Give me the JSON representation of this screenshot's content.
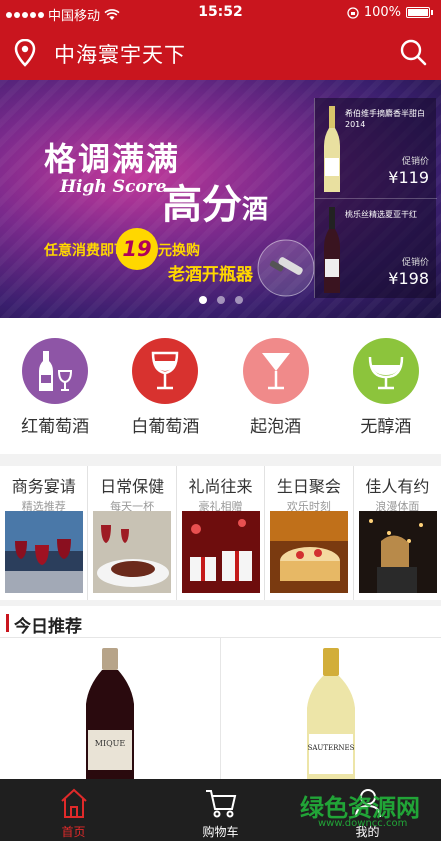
{
  "status_bar": {
    "carrier": "中国移动",
    "time": "15:52",
    "battery": "100%"
  },
  "header": {
    "title": "中海寰宇天下"
  },
  "banner": {
    "title_line1": "格调满满",
    "title_line2": "高分",
    "title_line2_suffix": "酒",
    "english": "High Score",
    "promo_prefix": "任意消费即可",
    "promo_number": "19",
    "promo_suffix": "元换购",
    "promo_item": "老酒开瓶器",
    "products": [
      {
        "name": "希伯维手摘麝香半甜白 2014",
        "price_label": "促销价",
        "price": "¥119"
      },
      {
        "name": "桃乐丝精选夏亚干红",
        "price_label": "促销价",
        "price": "¥198"
      }
    ],
    "page_indicator": {
      "count": 3,
      "active": 1
    }
  },
  "categories": [
    {
      "label": "红葡萄酒",
      "icon": "red-wine-icon",
      "color": "#8e55a6"
    },
    {
      "label": "白葡萄酒",
      "icon": "white-wine-icon",
      "color": "#d8322f"
    },
    {
      "label": "起泡酒",
      "icon": "sparkling-wine-icon",
      "color": "#f08a8a"
    },
    {
      "label": "无醇酒",
      "icon": "non-alcoholic-icon",
      "color": "#8cc43c"
    }
  ],
  "occasions": [
    {
      "title": "商务宴请",
      "subtitle": "精选推荐"
    },
    {
      "title": "日常保健",
      "subtitle": "每天一杯"
    },
    {
      "title": "礼尚往来",
      "subtitle": "豪礼相赠"
    },
    {
      "title": "生日聚会",
      "subtitle": "欢乐时刻"
    },
    {
      "title": "佳人有约",
      "subtitle": "浪漫体面"
    }
  ],
  "recommend": {
    "title": "今日推荐",
    "items": [
      {
        "label": "MIQUE"
      },
      {
        "label": "SAUTERNES"
      }
    ]
  },
  "tabbar": {
    "tabs": [
      {
        "label": "首页",
        "icon": "home-icon",
        "active": true
      },
      {
        "label": "购物车",
        "icon": "cart-icon",
        "active": false
      },
      {
        "label": "我的",
        "icon": "user-icon",
        "active": false
      }
    ]
  },
  "watermark": {
    "text": "绿色资源网",
    "url": "www.downcc.com"
  },
  "colors": {
    "brand": "#c9151e",
    "tabbar": "#1f1f1f",
    "active_tab": "#e02a2a"
  }
}
